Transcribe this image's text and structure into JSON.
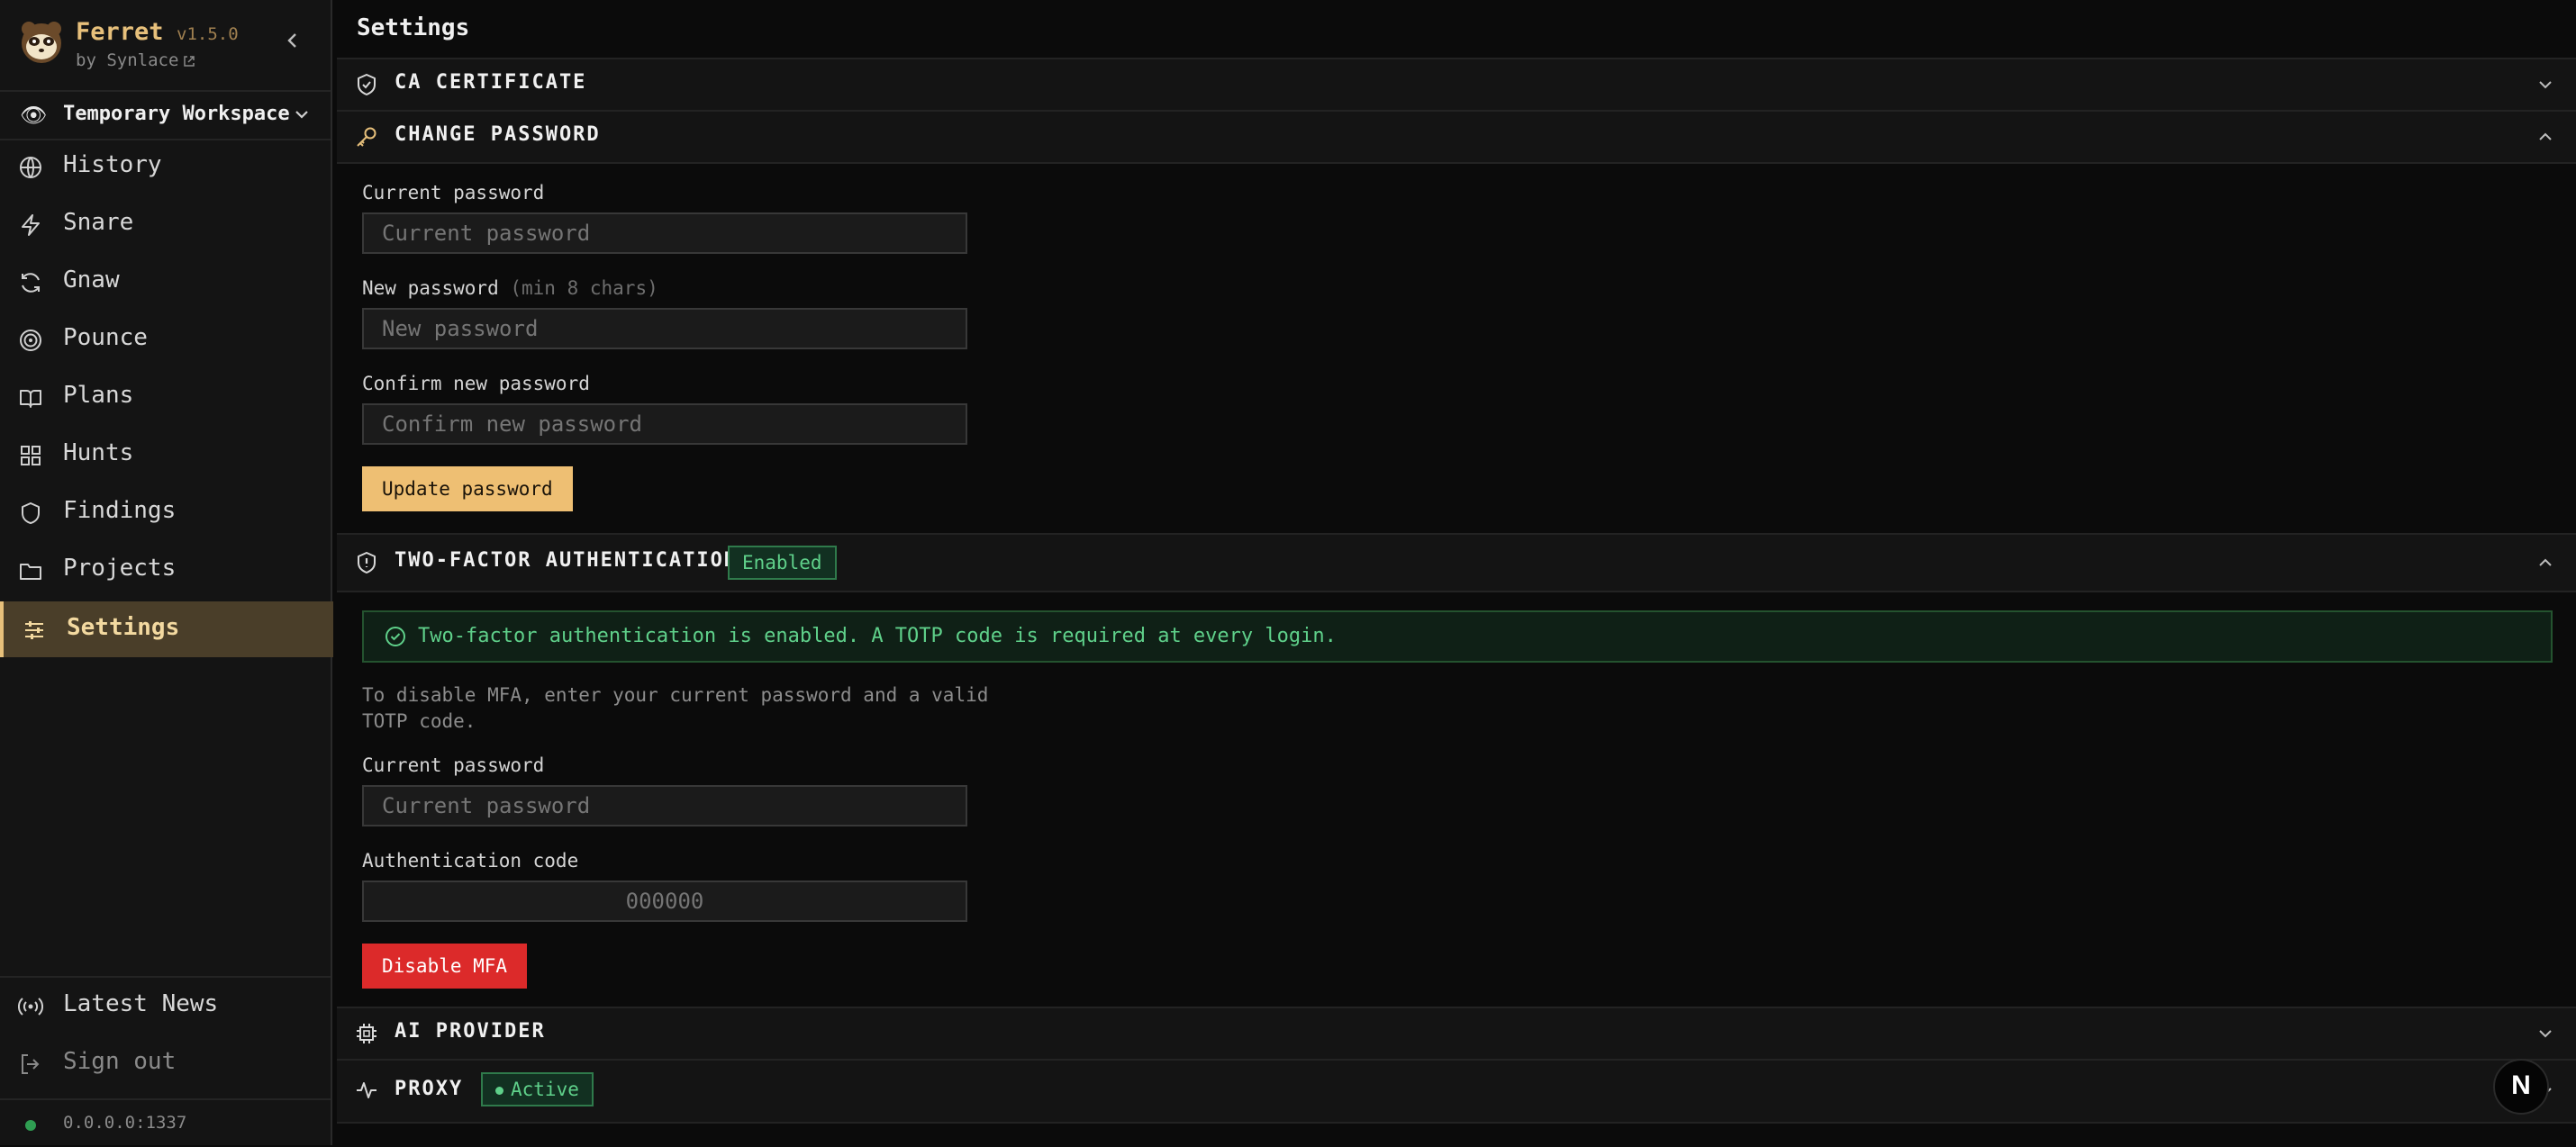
{
  "app": {
    "name": "Ferret",
    "version": "v1.5.0",
    "by": "by Synlace",
    "workspace": "Temporary Workspace",
    "address": "0.0.0.0:1337"
  },
  "sidebar": {
    "items": [
      {
        "label": "History",
        "icon": "globe-icon"
      },
      {
        "label": "Snare",
        "icon": "zap-icon"
      },
      {
        "label": "Gnaw",
        "icon": "refresh-icon"
      },
      {
        "label": "Pounce",
        "icon": "target-icon"
      },
      {
        "label": "Plans",
        "icon": "book-icon"
      },
      {
        "label": "Hunts",
        "icon": "grid-icon"
      },
      {
        "label": "Findings",
        "icon": "shield-icon"
      },
      {
        "label": "Projects",
        "icon": "folder-icon"
      },
      {
        "label": "Settings",
        "icon": "sliders-icon"
      }
    ],
    "active": "Settings",
    "bottom": [
      {
        "label": "Latest News",
        "icon": "broadcast-icon"
      },
      {
        "label": "Sign out",
        "icon": "logout-icon"
      }
    ]
  },
  "page": {
    "title": "Settings"
  },
  "sections": {
    "ca": {
      "title": "CA CERTIFICATE"
    },
    "password": {
      "title": "CHANGE PASSWORD",
      "current_label": "Current password",
      "current_placeholder": "Current password",
      "new_label": "New password",
      "new_hint": "(min 8 chars)",
      "new_placeholder": "New password",
      "confirm_label": "Confirm new password",
      "confirm_placeholder": "Confirm new password",
      "submit": "Update password"
    },
    "mfa": {
      "title": "TWO-FACTOR AUTHENTICATION",
      "badge": "Enabled",
      "notice": "Two-factor authentication is enabled. A TOTP code is required at every login.",
      "description": "To disable MFA, enter your current password and a valid TOTP code.",
      "current_label": "Current password",
      "current_placeholder": "Current password",
      "code_label": "Authentication code",
      "code_placeholder": "000000",
      "submit": "Disable MFA"
    },
    "ai": {
      "title": "AI PROVIDER"
    },
    "proxy": {
      "title": "PROXY",
      "badge": "Active"
    }
  },
  "fab": {
    "label": "N"
  },
  "colors": {
    "accent": "#e7c07b",
    "primary_button": "#eebf73",
    "danger": "#dc2a2a",
    "success": "#5fd08a",
    "status_dot": "#2f9e52"
  }
}
